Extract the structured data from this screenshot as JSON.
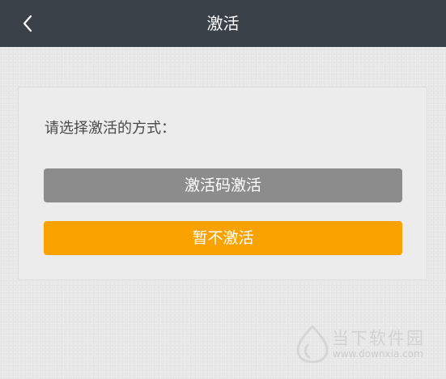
{
  "header": {
    "title": "激活",
    "back_icon": "chevron-left-icon"
  },
  "activation": {
    "prompt": "请选择激活的方式：",
    "code_button_label": "激活码激活",
    "later_button_label": "暂不激活"
  },
  "colors": {
    "header_bg": "#3b4149",
    "code_button_bg": "#8c8c8c",
    "later_button_bg": "#f9a200"
  },
  "watermark": {
    "name": "当下软件园",
    "url": "www.downxia.com"
  }
}
